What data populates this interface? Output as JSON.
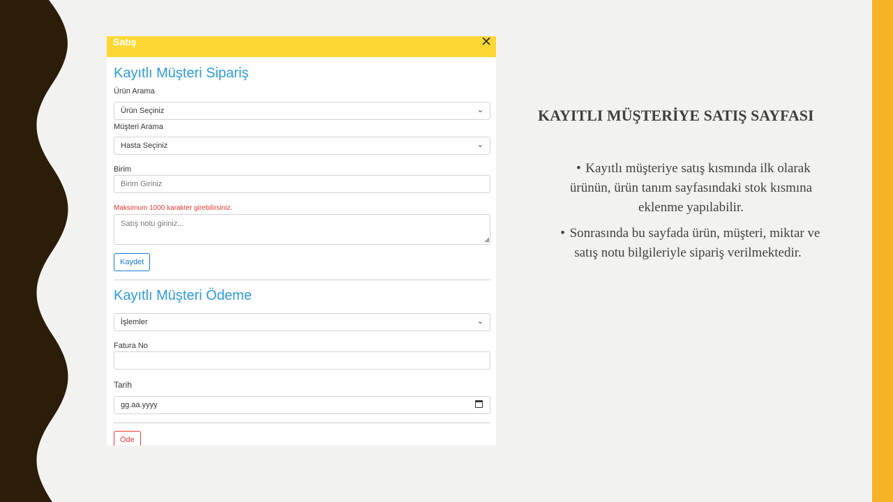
{
  "panel": {
    "title": "Satış",
    "close": "✕",
    "order": {
      "heading": "Kayıtlı Müşteri Sipariş",
      "product_label": "Ürün Arama",
      "product_value": "Ürün Seçiniz",
      "customer_label": "Müşteri Arama",
      "customer_value": "Hasta Seçiniz",
      "unit_label": "Birim",
      "unit_placeholder": "Birim Giriniz",
      "note_warning": "Maksimum 1000 karakter girebilirsiniz.",
      "note_placeholder": "Satış notu giriniz...",
      "save_label": "Kaydet"
    },
    "payment": {
      "heading": "Kayıtlı Müşteri Ödeme",
      "operations_value": "İşlemler",
      "invoice_label": "Fatura No",
      "invoice_value": "",
      "date_label": "Tarih",
      "date_placeholder": "gg.aa.yyyy",
      "pay_label": "Öde"
    }
  },
  "slide": {
    "title": "KAYITLI MÜŞTERİYE SATIŞ SAYFASI",
    "bullets": [
      {
        "line1": "Kayıtlı müşteriye satış kısmında ilk olarak",
        "line2": "ürünün, ürün tanım sayfasındaki stok kısmına",
        "line3": "eklenme yapılabilir."
      },
      {
        "line1": "Sonrasında bu sayfada ürün, müşteri, miktar ve",
        "line2": "satış notu bilgileriyle sipariş verilmektedir."
      }
    ]
  },
  "colors": {
    "accent_yellow": "#fdd835",
    "accent_orange": "#f5b325",
    "wave_dark": "#2b1d08",
    "heading_blue": "#2d9cdb",
    "error_red": "#e53935"
  }
}
